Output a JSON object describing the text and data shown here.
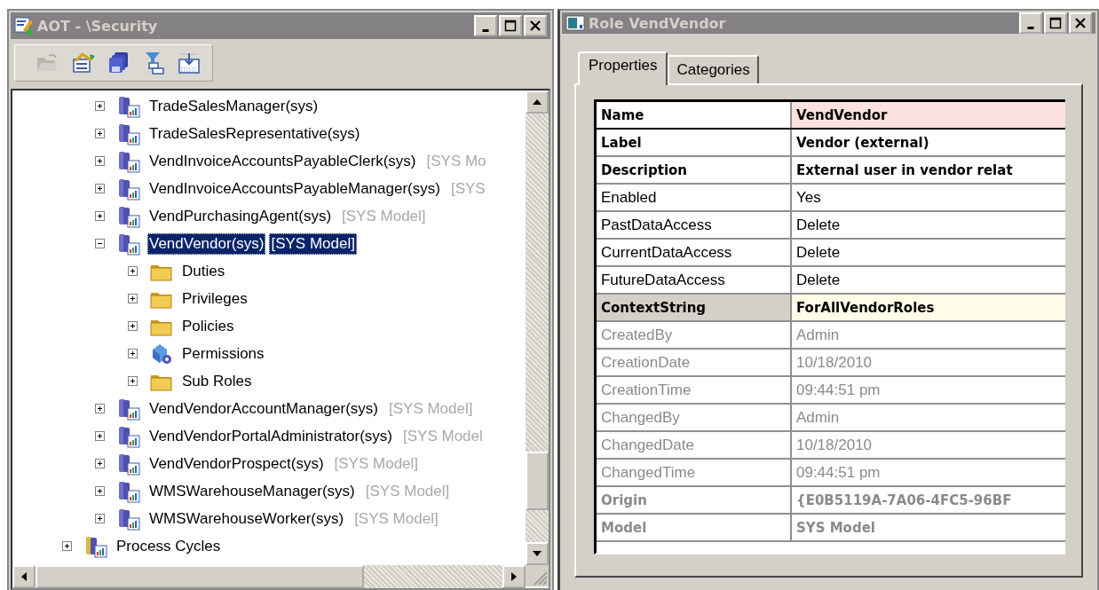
{
  "aot_window": {
    "title": "AOT - \\Security"
  },
  "tree": {
    "roles": [
      {
        "kind": "role",
        "label": "TradeSalesManager(sys)",
        "expanded": false,
        "selected": false
      },
      {
        "kind": "role",
        "label": "TradeSalesRepresentative(sys)",
        "expanded": false,
        "selected": false
      },
      {
        "kind": "role",
        "label": "VendInvoiceAccountsPayableClerk(sys)",
        "model": "[SYS Mo",
        "expanded": false,
        "selected": false
      },
      {
        "kind": "role",
        "label": "VendInvoiceAccountsPayableManager(sys)",
        "model": "[SYS",
        "expanded": false,
        "selected": false
      },
      {
        "kind": "role",
        "label": "VendPurchasingAgent(sys)",
        "model": "[SYS Model]",
        "expanded": false,
        "selected": false
      },
      {
        "kind": "role",
        "label": "VendVendor(sys)",
        "model": "[SYS Model]",
        "expanded": true,
        "selected": true,
        "children": [
          {
            "kind": "folder",
            "label": "Duties",
            "expanded": false,
            "selected": false
          },
          {
            "kind": "folder",
            "label": "Privileges",
            "expanded": false,
            "selected": false
          },
          {
            "kind": "folder",
            "label": "Policies",
            "expanded": false,
            "selected": false
          },
          {
            "kind": "permissions",
            "label": "Permissions",
            "expanded": false,
            "selected": false
          },
          {
            "kind": "folder",
            "label": "Sub Roles",
            "expanded": false,
            "selected": false
          }
        ]
      },
      {
        "kind": "role",
        "label": "VendVendorAccountManager(sys)",
        "model": "[SYS Model]",
        "expanded": false,
        "selected": false
      },
      {
        "kind": "role",
        "label": "VendVendorPortalAdministrator(sys)",
        "model": "[SYS Model",
        "expanded": false,
        "selected": false
      },
      {
        "kind": "role",
        "label": "VendVendorProspect(sys)",
        "model": "[SYS Model]",
        "expanded": false,
        "selected": false
      },
      {
        "kind": "role",
        "label": "WMSWarehouseManager(sys)",
        "model": "[SYS Model]",
        "expanded": false,
        "selected": false
      },
      {
        "kind": "role",
        "label": "WMSWarehouseWorker(sys)",
        "model": "[SYS Model]",
        "expanded": false,
        "selected": false
      }
    ],
    "root_items": [
      {
        "kind": "role_group",
        "label": "Process Cycles",
        "expanded": false,
        "selected": false
      }
    ]
  },
  "role_window": {
    "title": "Role VendVendor"
  },
  "tabs": [
    {
      "label": "Properties",
      "selected": true
    },
    {
      "label": "Categories",
      "selected": false
    }
  ],
  "properties": [
    {
      "name": "Name",
      "value": "VendVendor",
      "bold": true,
      "readonly": false,
      "mandatory": true,
      "selected": false
    },
    {
      "name": "Label",
      "value": "Vendor (external)",
      "bold": true,
      "readonly": false,
      "mandatory": false,
      "selected": false
    },
    {
      "name": "Description",
      "value": "External user in vendor relat",
      "bold": true,
      "readonly": false,
      "mandatory": false,
      "selected": false
    },
    {
      "name": "Enabled",
      "value": "Yes",
      "bold": false,
      "readonly": false,
      "mandatory": false,
      "selected": false
    },
    {
      "name": "PastDataAccess",
      "value": "Delete",
      "bold": false,
      "readonly": false,
      "mandatory": false,
      "selected": false
    },
    {
      "name": "CurrentDataAccess",
      "value": "Delete",
      "bold": false,
      "readonly": false,
      "mandatory": false,
      "selected": false
    },
    {
      "name": "FutureDataAccess",
      "value": "Delete",
      "bold": false,
      "readonly": false,
      "mandatory": false,
      "selected": false
    },
    {
      "name": "ContextString",
      "value": "ForAllVendorRoles",
      "bold": true,
      "readonly": false,
      "mandatory": false,
      "selected": true
    },
    {
      "name": "CreatedBy",
      "value": "Admin",
      "bold": false,
      "readonly": true,
      "mandatory": false,
      "selected": false
    },
    {
      "name": "CreationDate",
      "value": "10/18/2010",
      "bold": false,
      "readonly": true,
      "mandatory": false,
      "selected": false
    },
    {
      "name": "CreationTime",
      "value": "09:44:51 pm",
      "bold": false,
      "readonly": true,
      "mandatory": false,
      "selected": false
    },
    {
      "name": "ChangedBy",
      "value": "Admin",
      "bold": false,
      "readonly": true,
      "mandatory": false,
      "selected": false
    },
    {
      "name": "ChangedDate",
      "value": "10/18/2010",
      "bold": false,
      "readonly": true,
      "mandatory": false,
      "selected": false
    },
    {
      "name": "ChangedTime",
      "value": "09:44:51 pm",
      "bold": false,
      "readonly": true,
      "mandatory": false,
      "selected": false
    },
    {
      "name": "Origin",
      "value": "{E0B5119A-7A06-4FC5-96BF",
      "bold": true,
      "readonly": true,
      "mandatory": false,
      "selected": false
    },
    {
      "name": "Model",
      "value": "SYS Model",
      "bold": true,
      "readonly": true,
      "mandatory": false,
      "selected": false
    }
  ]
}
